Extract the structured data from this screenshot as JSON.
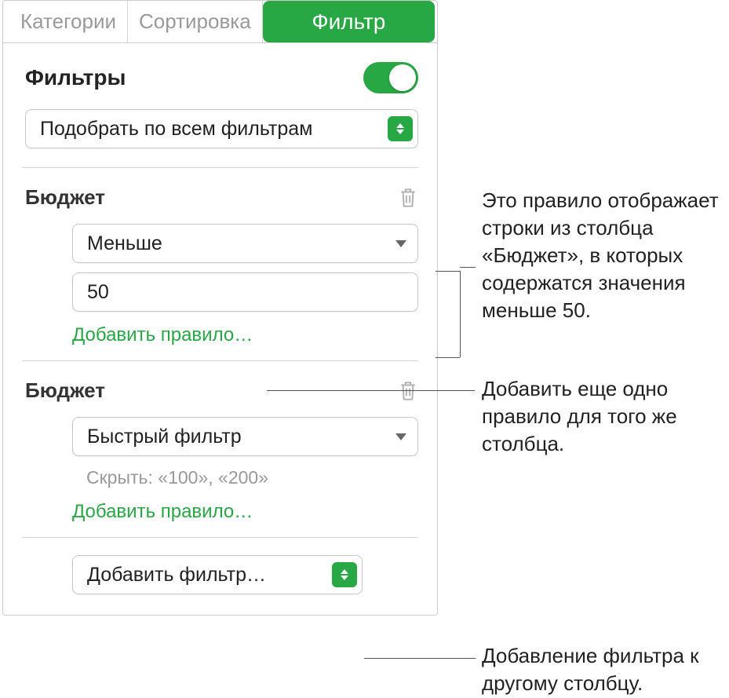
{
  "tabs": {
    "categories": "Категории",
    "sort": "Сортировка",
    "filter": "Фильтр"
  },
  "header": {
    "title": "Фильтры"
  },
  "match_mode": "Подобрать по всем фильтрам",
  "groups": [
    {
      "column": "Бюджет",
      "condition": "Меньше",
      "value": "50",
      "add_rule": "Добавить правило…"
    },
    {
      "column": "Бюджет",
      "condition": "Быстрый фильтр",
      "hide_text": "Скрыть: «100», «200»",
      "add_rule": "Добавить правило…"
    }
  ],
  "add_filter": "Добавить фильтр…",
  "callouts": {
    "rule_desc": "Это правило отображает строки из столбца «Бюджет», в которых содержатся значения меньше 50.",
    "add_rule_desc": "Добавить еще одно правило для того же столбца.",
    "add_filter_desc": "Добавление фильтра к другому столбцу."
  }
}
